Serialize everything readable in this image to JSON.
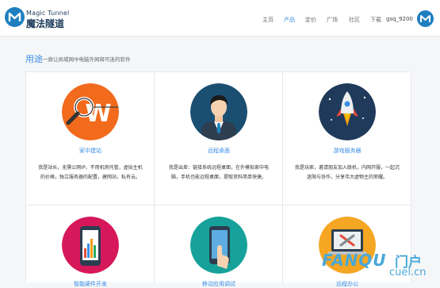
{
  "brand": {
    "name_en": "Magic Tunnel",
    "name_cn": "魔法隧道",
    "color": "#1e7fc0",
    "icon": "magic-tunnel-logo-icon"
  },
  "nav": {
    "items": [
      {
        "label": "主页",
        "active": false
      },
      {
        "label": "产品",
        "active": true
      },
      {
        "label": "定价",
        "active": false
      },
      {
        "label": "广场",
        "active": false
      },
      {
        "label": "社区",
        "active": false
      },
      {
        "label": "下载",
        "active": false
      }
    ],
    "user": "gsq_9200",
    "active_color": "#3a8ee6"
  },
  "section": {
    "title": "用途",
    "subtitle": "一款让局域网中电脑外网释可连的软件"
  },
  "cards": [
    {
      "title": "家中建站",
      "desc": "我是站长，无需公网IP，不用机房托管，虚拟主机的价格，独立服务器的配置，建网站，私有云。",
      "icon": "magnifier-website-icon"
    },
    {
      "title": "远程桌面",
      "desc": "我是出差：链接系统远程桌面，在外模拟家中电脑，手机也能远程桌面，提取资料简单快捷。",
      "icon": "businessman-icon"
    },
    {
      "title": "游戏服务器",
      "desc": "我是玩家，邀请朋友加入联机，内网开服，一起沉迷限与协作，分享伟大虚物主的荣耀。",
      "icon": "rocket-icon"
    },
    {
      "title": "智能硬件开发",
      "desc": "",
      "icon": "mobile-chart-icon"
    },
    {
      "title": "移动应用调试",
      "desc": "",
      "icon": "touch-phone-icon"
    },
    {
      "title": "远程办公",
      "desc": "",
      "icon": "laptop-tools-icon"
    }
  ],
  "watermark": {
    "text_en": "FANQU",
    "text_cn": "门户",
    "domain": "cuel.cn"
  }
}
